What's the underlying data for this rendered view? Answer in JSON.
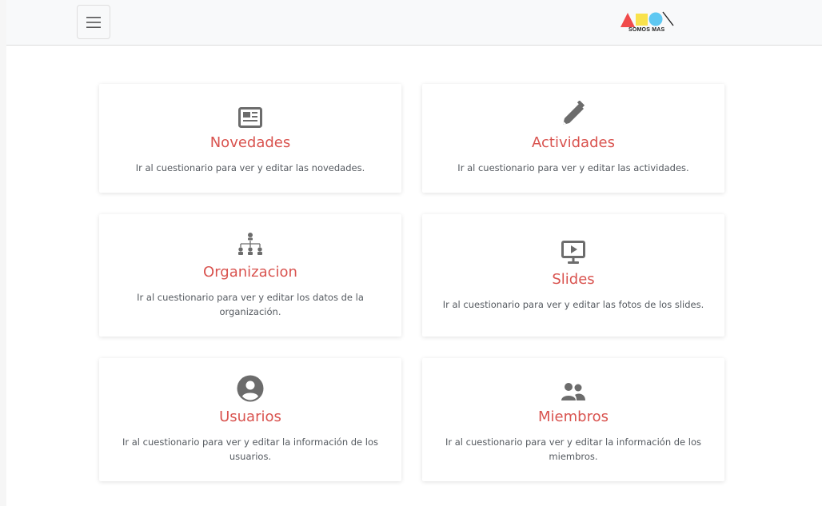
{
  "navbar": {
    "logo_text": "SOMOS MAS"
  },
  "cards": [
    {
      "title": "Novedades",
      "description": "Ir al cuestionario para ver y editar las novedades.",
      "icon": "newspaper-icon"
    },
    {
      "title": "Actividades",
      "description": "Ir al cuestionario para ver y editar las actividades.",
      "icon": "pencil-icon"
    },
    {
      "title": "Organizacion",
      "description": "Ir al cuestionario para ver y editar los datos de la organización.",
      "icon": "org-chart-icon"
    },
    {
      "title": "Slides",
      "description": "Ir al cuestionario para ver y editar las fotos de los slides.",
      "icon": "presentation-icon"
    },
    {
      "title": "Usuarios",
      "description": "Ir al cuestionario para ver y editar la información de los usuarios.",
      "icon": "user-circle-icon"
    },
    {
      "title": "Miembros",
      "description": "Ir al cuestionario para ver y editar la información de los miembros.",
      "icon": "users-icon"
    }
  ],
  "colors": {
    "accent": "#d9534f",
    "icon": "#6c6c6c",
    "logo_red": "#f04b4b",
    "logo_yellow": "#f9e24c",
    "logo_blue": "#5ec8f2"
  }
}
